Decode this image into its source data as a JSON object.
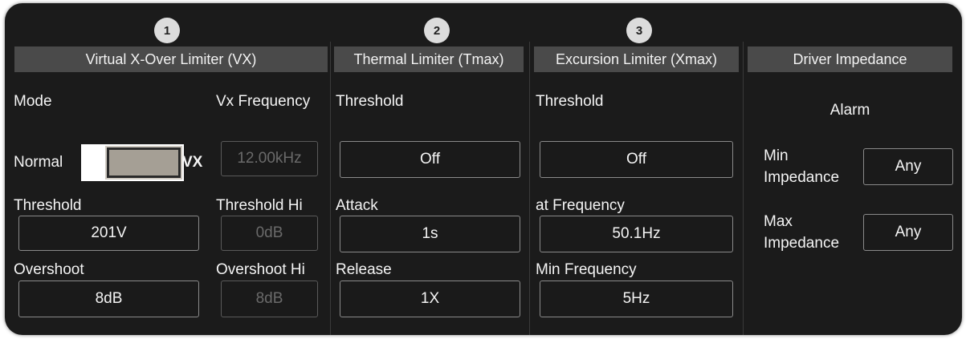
{
  "badges": [
    "1",
    "2",
    "3"
  ],
  "headers": {
    "vx": "Virtual X-Over Limiter (VX)",
    "thermal": "Thermal Limiter (Tmax)",
    "excursion": "Excursion Limiter (Xmax)",
    "impedance": "Driver Impedance"
  },
  "vx": {
    "mode_label": "Mode",
    "freq_label": "Vx Frequency",
    "normal_label": "Normal",
    "vx_label": "VX",
    "freq_value": "12.00kHz",
    "threshold_label": "Threshold",
    "threshold_value": "201V",
    "threshold_hi_label": "Threshold Hi",
    "threshold_hi_value": "0dB",
    "overshoot_label": "Overshoot",
    "overshoot_value": "8dB",
    "overshoot_hi_label": "Overshoot Hi",
    "overshoot_hi_value": "8dB"
  },
  "thermal": {
    "threshold_label": "Threshold",
    "threshold_value": "Off",
    "attack_label": "Attack",
    "attack_value": "1s",
    "release_label": "Release",
    "release_value": "1X"
  },
  "excursion": {
    "threshold_label": "Threshold",
    "threshold_value": "Off",
    "freq_label": "at Frequency",
    "freq_value": "50.1Hz",
    "min_freq_label": "Min Frequency",
    "min_freq_value": "5Hz"
  },
  "impedance": {
    "alarm_label": "Alarm",
    "min_label_1": "Min",
    "min_label_2": "Impedance",
    "min_value": "Any",
    "max_label_1": "Max",
    "max_label_2": "Impedance",
    "max_value": "Any"
  },
  "colors": {
    "panel_bg": "#1b1b1b",
    "header_bg": "#4a4a4a",
    "toggle_track": "#a59f95"
  }
}
